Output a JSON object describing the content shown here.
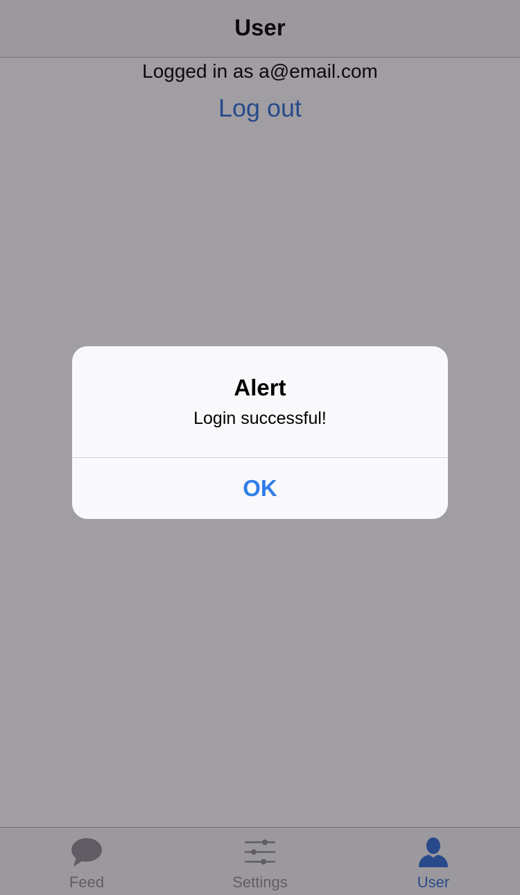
{
  "navbar": {
    "title": "User"
  },
  "content": {
    "logged_in_text": "Logged in as a@email.com",
    "logout_label": "Log out"
  },
  "alert": {
    "title": "Alert",
    "message": "Login successful!",
    "ok_label": "OK"
  },
  "tabbar": {
    "tabs": [
      {
        "label": "Feed",
        "icon": "speech-bubble-icon",
        "active": false
      },
      {
        "label": "Settings",
        "icon": "sliders-icon",
        "active": false
      },
      {
        "label": "User",
        "icon": "person-icon",
        "active": true
      }
    ]
  },
  "colors": {
    "accent": "#2f6fd6",
    "alert_button": "#2f7ee8",
    "inactive_tab": "#8e8e93"
  }
}
